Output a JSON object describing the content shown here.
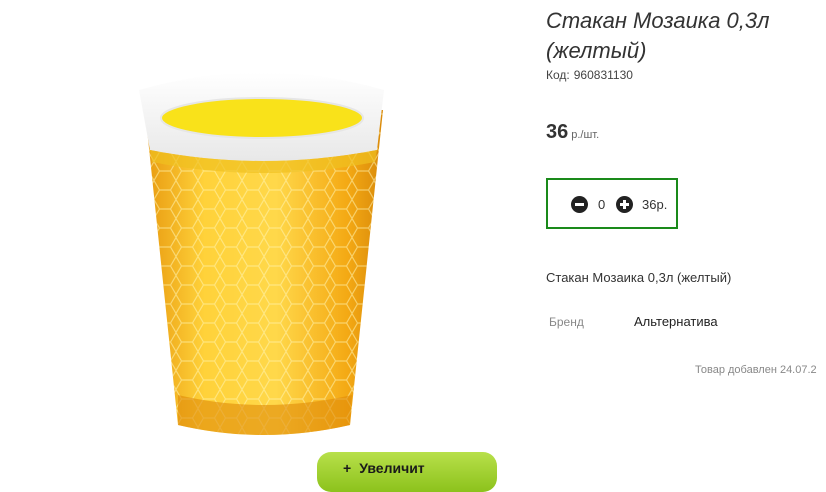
{
  "product": {
    "title": "Стакан Мозаика 0,3л (желтый)",
    "code_label": "Код:",
    "code_value": "960831130",
    "price_value": "36",
    "price_unit": "р./шт.",
    "description": "Стакан Мозаика 0,3л (желтый)",
    "brand_label": "Бренд",
    "brand_value": "Альтернатива",
    "added_text": "Товар добавлен 24.07.2"
  },
  "quantity": {
    "value": "0",
    "sum": "36р."
  },
  "cart_button": {
    "label": "Увеличит",
    "icon": "plus-icon"
  },
  "colors": {
    "accent_border": "#1a8a1a",
    "button_green": "#8cc21c",
    "cup_yellow": "#f6b21a"
  }
}
